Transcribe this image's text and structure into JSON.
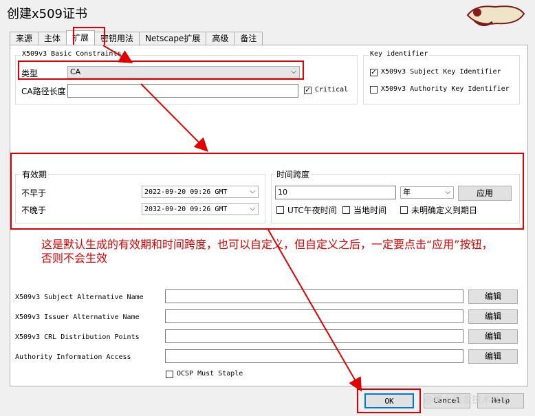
{
  "window": {
    "title": "创建x509证书"
  },
  "tabs": [
    {
      "label": "来源"
    },
    {
      "label": "主体"
    },
    {
      "label": "扩展"
    },
    {
      "label": "密钥用法"
    },
    {
      "label": "Netscape扩展"
    },
    {
      "label": "高级"
    },
    {
      "label": "备注"
    }
  ],
  "basic_constraints": {
    "legend": "X509v3 Basic Constraints",
    "type_label": "类型",
    "type_value": "CA",
    "path_label": "CA路径长度",
    "path_value": "",
    "critical_label": "Critical",
    "critical_checked": true
  },
  "key_identifier": {
    "legend": "Key identifier",
    "subject_label": "X509v3 Subject Key Identifier",
    "subject_checked": true,
    "authority_label": "X509v3 Authority Key Identifier",
    "authority_checked": false
  },
  "validity": {
    "legend": "有效期",
    "not_before_label": "不早于",
    "not_before_value": "2022-09-20 09:26 GMT",
    "not_after_label": "不晚于",
    "not_after_value": "2032-09-20 09:26 GMT"
  },
  "timespan": {
    "legend": "时间跨度",
    "amount": "10",
    "unit": "年",
    "apply_label": "应用",
    "utc_label": "UTC午夜时间",
    "local_label": "当地时间",
    "undefined_label": "未明确定义到期日"
  },
  "annotation": "这是默认生成的有效期和时间跨度，也可以自定义，但自定义之后，一定要点击“应用”按钮，否则不会生效",
  "extensions": [
    {
      "label": "X509v3 Subject Alternative Name",
      "value": "",
      "button": "编辑"
    },
    {
      "label": "X509v3 Issuer Alternative Name",
      "value": "",
      "button": "编辑"
    },
    {
      "label": "X509v3 CRL Distribution Points",
      "value": "",
      "button": "编辑"
    },
    {
      "label": "Authority Information Access",
      "value": "",
      "button": "编辑"
    }
  ],
  "ocsp": {
    "label": "OCSP Must Staple",
    "checked": false
  },
  "footer": {
    "ok_label": "OK",
    "cancel_label": "Cancel",
    "help_label": "Help"
  },
  "watermark": "@稀土掘金技术社区",
  "colors": {
    "highlight": "#e00000",
    "panel": "#ffffff",
    "window": "#f0f0f0"
  }
}
